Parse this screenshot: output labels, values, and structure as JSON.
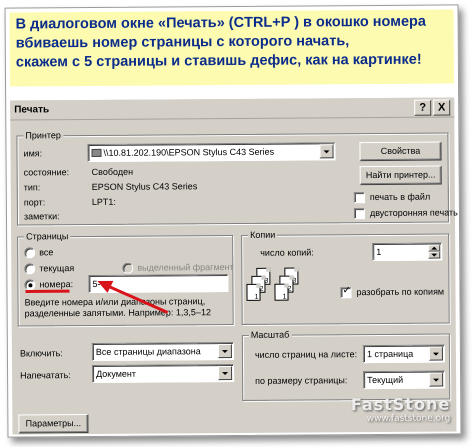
{
  "banner": {
    "line1": "В диалоговом окне «Печать» (CTRL+P )  в окошко номера",
    "line2": "вбиваешь номер страницы с которого начать,",
    "line3": "скажем с 5 страницы и ставишь дефис, как на картинке!"
  },
  "dialog": {
    "title": "Печать",
    "help_label": "?",
    "close_label": "X",
    "printer": {
      "group_label": "Принтер",
      "name_label": "имя:",
      "name_value": "\\\\10.81.202.190\\EPSON Stylus C43 Series",
      "status_label": "состояние:",
      "status_value": "Свободен",
      "type_label": "тип:",
      "type_value": "EPSON Stylus C43 Series",
      "port_label": "порт:",
      "port_value": "LPT1:",
      "notes_label": "заметки:",
      "properties_button": "Свойства",
      "find_button": "Найти принтер...",
      "print_to_file_label": "печать в файл",
      "duplex_label": "двусторонняя печать"
    },
    "pages": {
      "group_label": "Страницы",
      "all_label": "все",
      "current_label": "текущая",
      "selection_label": "выделенный фрагмент",
      "numbers_label": "номера:",
      "numbers_value": "5-",
      "hint": "Введите номера и/или диапазоны страниц, разделенные запятыми. Например: 1,3,5–12"
    },
    "copies": {
      "group_label": "Копии",
      "count_label": "число копий:",
      "count_value": "1",
      "collate_label": "разобрать по копиям"
    },
    "include_label": "Включить:",
    "include_value": "Все страницы диапазона",
    "print_what_label": "Напечатать:",
    "print_what_value": "Документ",
    "scale": {
      "group_label": "Масштаб",
      "pages_per_sheet_label": "число страниц на листе:",
      "pages_per_sheet_value": "1 страница",
      "fit_label": "по размеру страницы:",
      "fit_value": "Текущий"
    },
    "options_button": "Параметры..."
  },
  "watermark": {
    "logo": "FastStone",
    "url": "www.faststone.org"
  }
}
